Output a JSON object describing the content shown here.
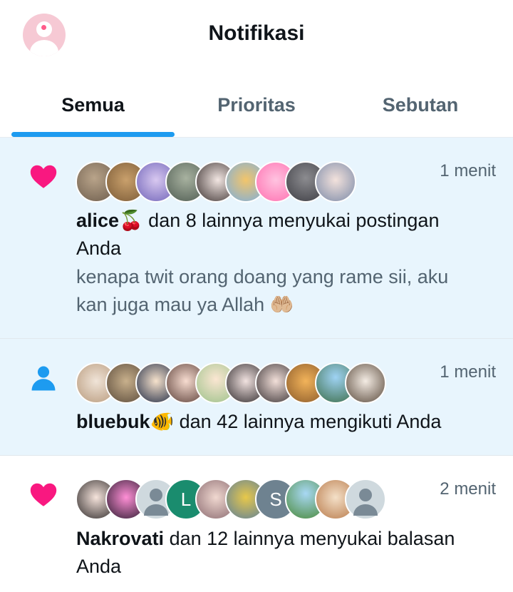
{
  "header": {
    "title": "Notifikasi",
    "profile_icon": "profile-avatar-icon"
  },
  "tabs": [
    {
      "label": "Semua",
      "active": true
    },
    {
      "label": "Prioritas",
      "active": false
    },
    {
      "label": "Sebutan",
      "active": false
    }
  ],
  "colors": {
    "accent": "#1d9bf0",
    "like": "#f91880",
    "follow": "#1d9bf0",
    "unread_bg": "#e8f5fd",
    "secondary_text": "#536471"
  },
  "notifications": [
    {
      "type": "like",
      "icon": "heart-icon",
      "time": "1 menit",
      "user": "alice🍒",
      "action": " dan 8 lainnya menyukai postingan Anda",
      "snippet": "kenapa twit orang doang yang rame sii, aku kan juga mau  ya Allah 🤲🏼"
    },
    {
      "type": "follow",
      "icon": "person-icon",
      "time": "1 menit",
      "user": "bluebuk🐠",
      "action": " dan 42 lainnya mengikuti Anda"
    },
    {
      "type": "like",
      "icon": "heart-icon",
      "time": "2 menit",
      "user": "Nakrovati",
      "action": " dan 12 lainnya menyukai balasan Anda",
      "avatar_letters": [
        "L",
        "S"
      ]
    }
  ]
}
